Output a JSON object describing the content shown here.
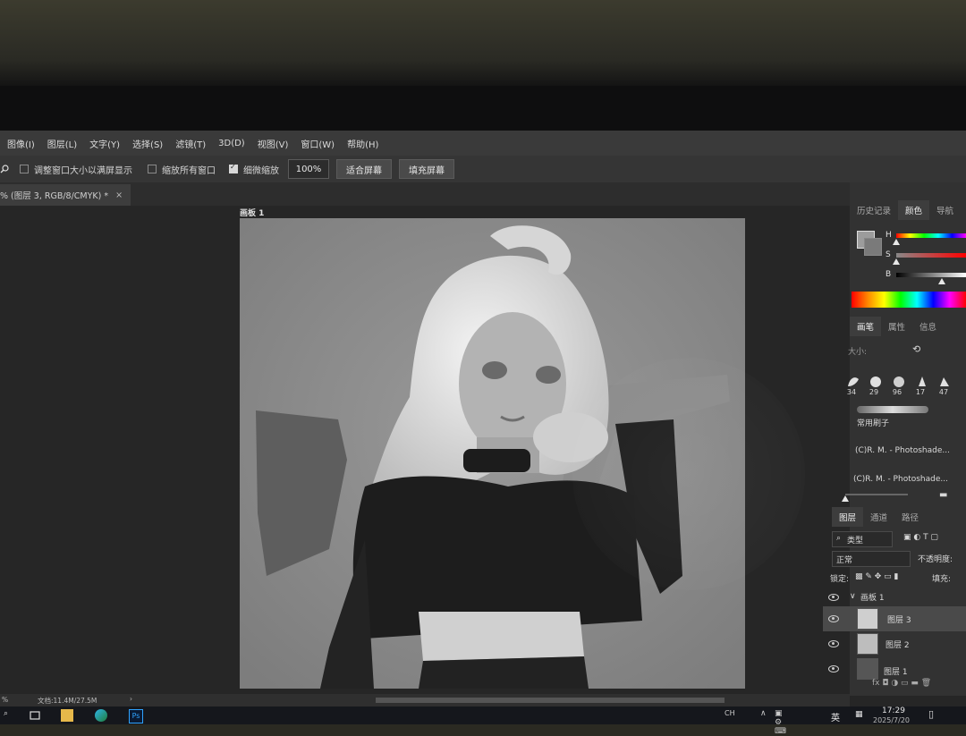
{
  "menu": [
    "图像(I)",
    "图层(L)",
    "文字(Y)",
    "选择(S)",
    "滤镜(T)",
    "3D(D)",
    "视图(V)",
    "窗口(W)",
    "帮助(H)"
  ],
  "options": {
    "resize_windows": "调整窗口大小以满屏显示",
    "zoom_all": "缩放所有窗口",
    "scrubby_zoom": "细微缩放",
    "zoom_value": "100%",
    "fit_screen": "适合屏幕",
    "fill_screen": "填充屏幕"
  },
  "document_tab": {
    "title": "% (图层 3, RGB/8/CMYK) *",
    "close": "×"
  },
  "artboard_label": "画板 1",
  "right_panel": {
    "top_tabs": [
      "历史记录",
      "颜色",
      "导航"
    ],
    "active_top_tab": "颜色",
    "color_sliders": [
      {
        "label": "H",
        "value": 0.0
      },
      {
        "label": "S",
        "value": 0.0
      },
      {
        "label": "B",
        "value": 0.65
      }
    ],
    "mid_tabs": [
      "画笔",
      "属性",
      "信息"
    ],
    "active_mid_tab": "画笔",
    "size_label": "大小:",
    "brush_sizes": [
      "34",
      "29",
      "96",
      "17",
      "47"
    ],
    "brush_group": "常用刷子",
    "presets": [
      "(C)R. M. - Photoshade...",
      "(C)R. M. - Photoshade..."
    ],
    "layer_tabs": [
      "图层",
      "通道",
      "路径"
    ],
    "active_layer_tab": "图层",
    "kind_filter": "类型",
    "blend_mode": "正常",
    "opacity_label": "不透明度:",
    "lock_label": "锁定:",
    "fill_label": "填充:",
    "artboard_group": "画板 1",
    "layers": [
      "图层 3",
      "图层 2",
      "图层 1"
    ],
    "selected_layer": "图层 3"
  },
  "status": {
    "zoom": "%",
    "doc_size": "文档:11.4M/27.5M"
  },
  "taskbar": {
    "ime_mode": "英",
    "time": "17:29",
    "date": "2025/7/20"
  }
}
